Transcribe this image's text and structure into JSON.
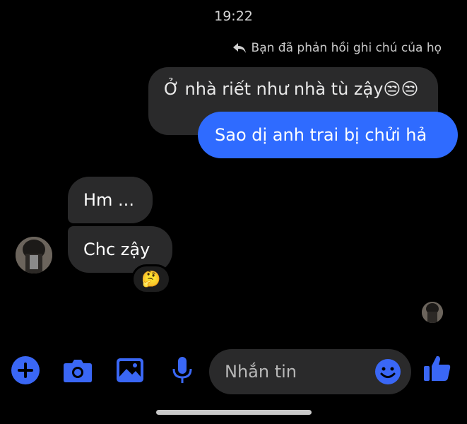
{
  "header": {
    "time": "19:22"
  },
  "reply_note": {
    "text": "Bạn đã phản hồi ghi chú của họ",
    "icon": "reply-arrow-icon"
  },
  "messages": {
    "note_quote": "Ở nhà riết như nhà tù zậy😒😒",
    "sent": "Sao dị anh trai bị chửi hả",
    "received": [
      "Hm ...",
      "Chc zậy"
    ],
    "reaction": "🤔"
  },
  "composer": {
    "placeholder": "Nhắn tin",
    "icons": [
      "plus-icon",
      "camera-icon",
      "image-icon",
      "microphone-icon",
      "emoji-icon",
      "thumbs-up-icon"
    ]
  },
  "colors": {
    "accent": "#2f6bff",
    "bubble": "#2a2a2b",
    "background": "#000000",
    "icon": "#3a67f5"
  }
}
